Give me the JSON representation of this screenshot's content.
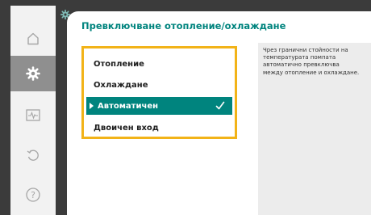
{
  "screen": {
    "title": "Превключване отопление/охлаждане",
    "options": [
      {
        "label": "Отопление",
        "selected": false
      },
      {
        "label": "Охлаждане",
        "selected": false
      },
      {
        "label": "Автоматичен",
        "selected": true
      },
      {
        "label": "Двоичен вход",
        "selected": false
      }
    ],
    "help_text": "Чрез гранични стойности на температурата помпата автоматично превключва между отопление и охлаждане."
  },
  "nav": {
    "items": [
      {
        "icon": "home-icon",
        "active": false
      },
      {
        "icon": "gear-icon",
        "active": true
      },
      {
        "icon": "diagnostics-monitor-icon",
        "active": false
      },
      {
        "icon": "undo-icon",
        "active": false
      },
      {
        "icon": "help-icon",
        "active": false
      }
    ]
  },
  "colors": {
    "accent": "#00847e",
    "focus_frame": "#f2b318",
    "rail_active": "#8f8f8f",
    "background": "#3b3b3b"
  }
}
